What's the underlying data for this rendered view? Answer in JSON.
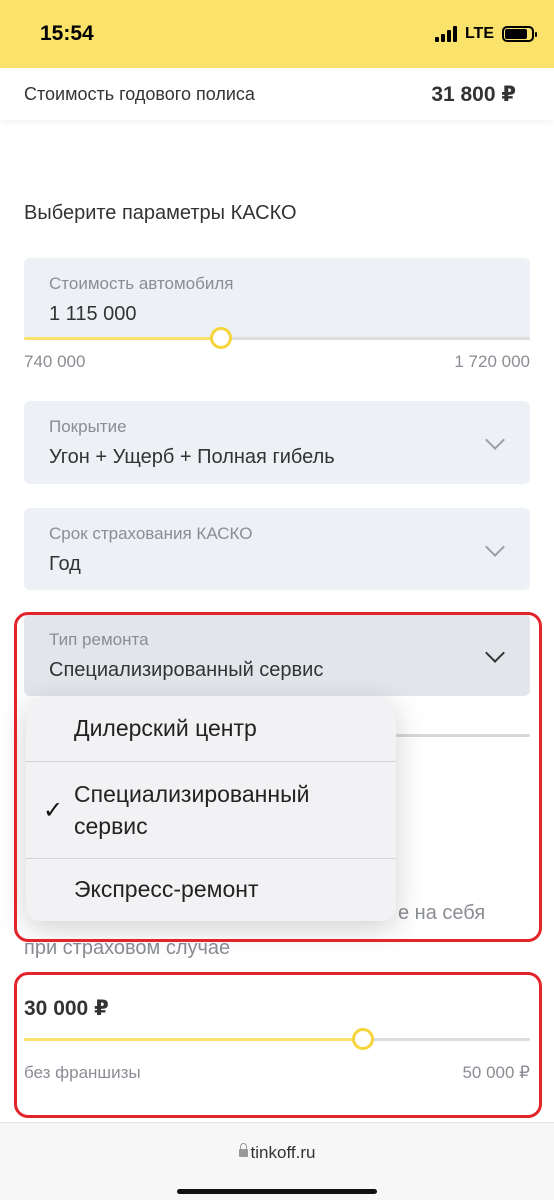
{
  "status_bar": {
    "time": "15:54",
    "network": "LTE"
  },
  "policy": {
    "label": "Стоимость годового полиса",
    "price": "31 800 ₽"
  },
  "section_title": "Выберите параметры КАСКО",
  "car_value": {
    "label": "Стоимость автомобиля",
    "value": "1 115 000",
    "min_label": "740 000",
    "max_label": "1 720 000",
    "slider_fraction": 0.39
  },
  "coverage": {
    "label": "Покрытие",
    "value": "Угон + Ущерб + Полная гибель"
  },
  "term": {
    "label": "Срок страхования КАСКО",
    "value": "Год"
  },
  "repair_type": {
    "label": "Тип ремонта",
    "value": "Специализированный сервис",
    "options": [
      {
        "label": "Дилерский центр",
        "selected": false
      },
      {
        "label": "Специализированный сервис",
        "selected": true
      },
      {
        "label": "Экспресс-ремонт",
        "selected": false
      }
    ],
    "checkmark": "✓"
  },
  "franchise": {
    "partial_text_1": "е на себя",
    "partial_text_2": "при страховом случае",
    "value": "30 000 ₽",
    "min_label": "без франшизы",
    "max_label": "50 000 ₽",
    "slider_fraction": 0.67
  },
  "browser": {
    "url": "tinkoff.ru"
  },
  "colors": {
    "accent_yellow": "#fae26b",
    "highlight_red": "#e3242b",
    "field_bg": "#edf0f5"
  }
}
